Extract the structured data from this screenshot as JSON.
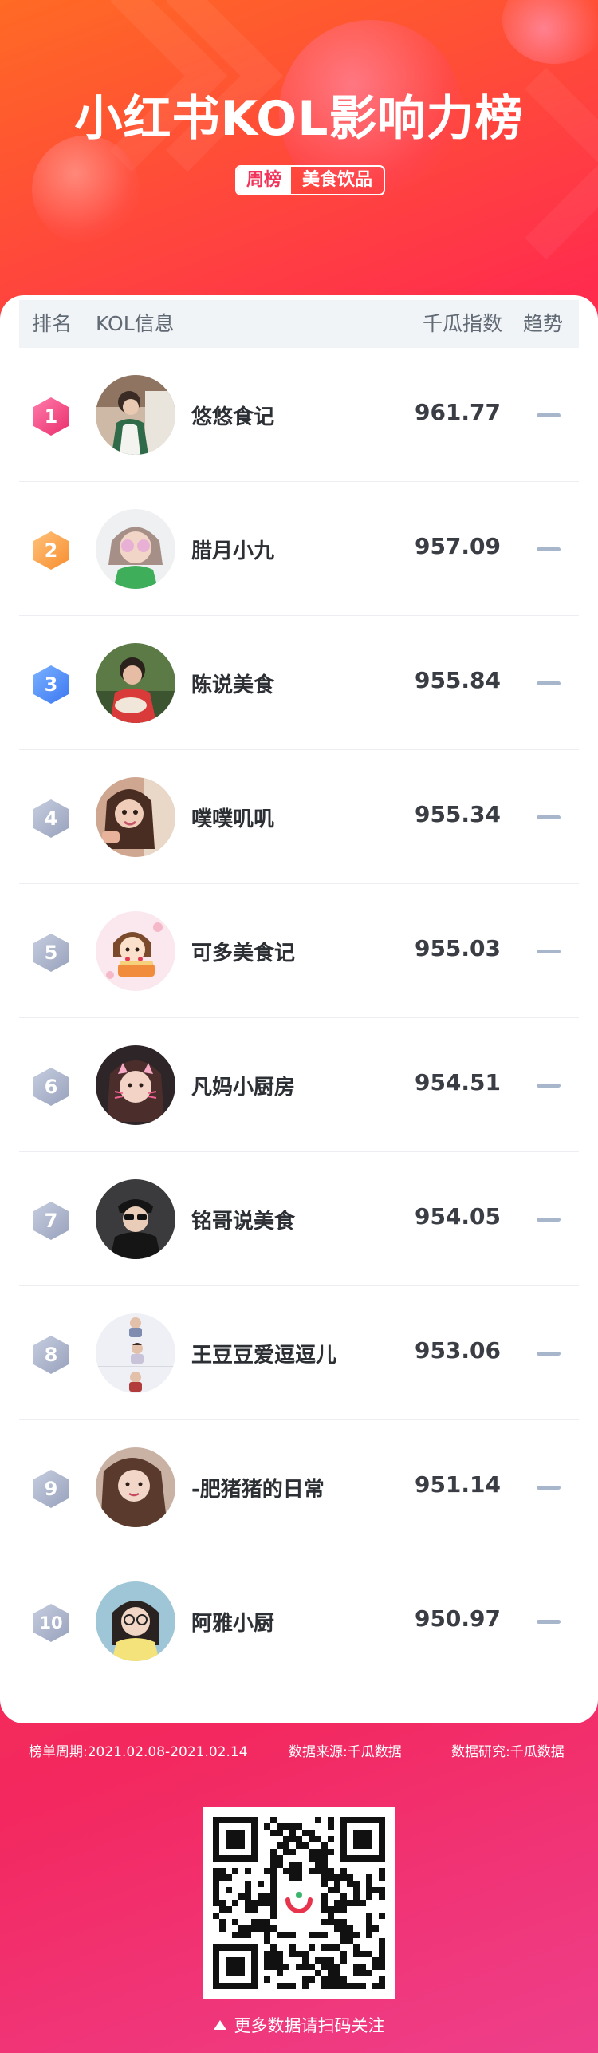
{
  "header": {
    "title": "小红书KOL影响力榜",
    "tag_period": "周榜",
    "tag_category": "美食饮品"
  },
  "table": {
    "columns": [
      "排名",
      "KOL信息",
      "千瓜指数",
      "趋势"
    ],
    "rows": [
      {
        "rank": "1",
        "name": "悠悠食记",
        "score": "961.77",
        "trend": "flat"
      },
      {
        "rank": "2",
        "name": "腊月小九",
        "score": "957.09",
        "trend": "flat"
      },
      {
        "rank": "3",
        "name": "陈说美食",
        "score": "955.84",
        "trend": "flat"
      },
      {
        "rank": "4",
        "name": "噗噗叽叽",
        "score": "955.34",
        "trend": "flat"
      },
      {
        "rank": "5",
        "name": "可多美食记",
        "score": "955.03",
        "trend": "flat"
      },
      {
        "rank": "6",
        "name": "凡妈小厨房",
        "score": "954.51",
        "trend": "flat"
      },
      {
        "rank": "7",
        "name": "铭哥说美食",
        "score": "954.05",
        "trend": "flat"
      },
      {
        "rank": "8",
        "name": "王豆豆爱逗逗儿",
        "score": "953.06",
        "trend": "flat"
      },
      {
        "rank": "9",
        "name": "-肥猪猪的日常",
        "score": "951.14",
        "trend": "flat"
      },
      {
        "rank": "10",
        "name": "阿雅小厨",
        "score": "950.97",
        "trend": "flat"
      }
    ]
  },
  "footer": {
    "period": "榜单周期:2021.02.08-2021.02.14",
    "source": "数据来源:千瓜数据",
    "research": "数据研究:千瓜数据",
    "qr_hint": "更多数据请扫码关注"
  },
  "colors": {
    "brand": "#f2345a",
    "rank_1": "#ea2f6d",
    "rank_2": "#f78e2f",
    "rank_3": "#3c77f2",
    "rank_other": "#98a2bc",
    "trend_flat": "#a7b6cb"
  }
}
